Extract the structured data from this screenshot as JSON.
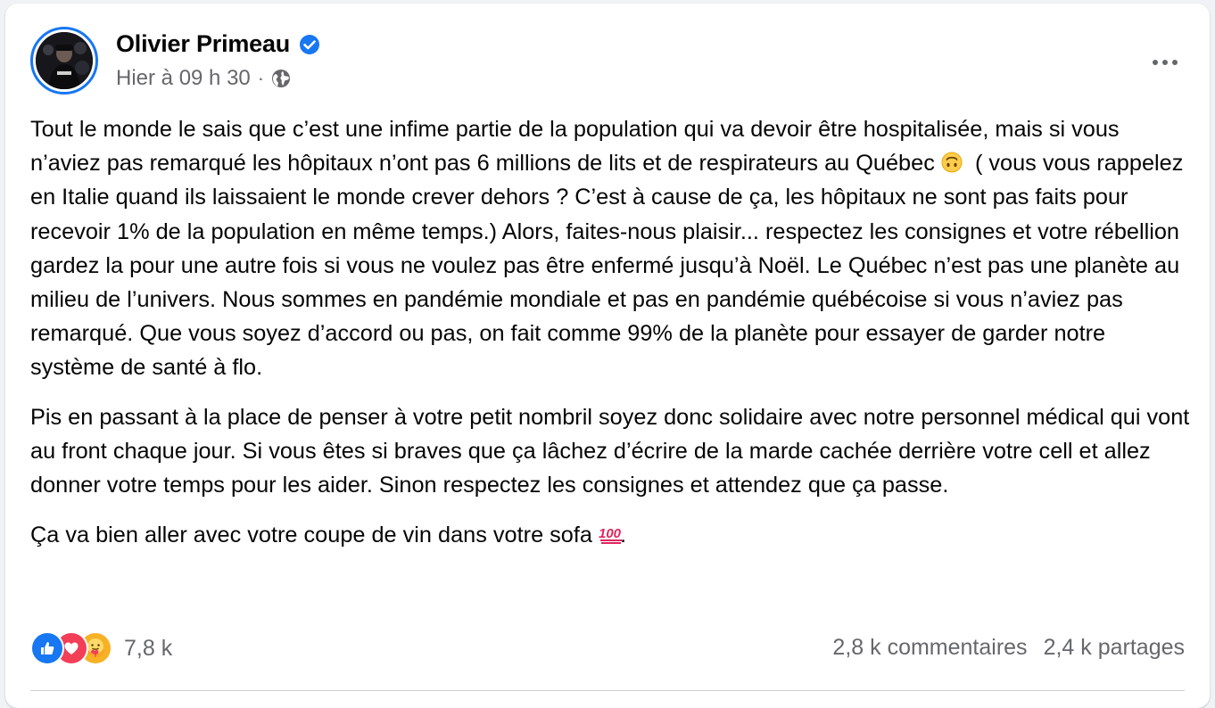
{
  "post": {
    "author": "Olivier Primeau",
    "verified": true,
    "timestamp": "Hier à 09 h 30",
    "separator": "·",
    "audience_icon": "globe-icon",
    "paragraphs": {
      "p1": {
        "before_emoji": "Tout le monde le sais que c’est une infime partie de la population qui va devoir être hospitalisée, mais si vous n’aviez pas remarqué les hôpitaux n’ont pas 6 millions de lits et de respirateurs au Québec",
        "emoji": "upside-down-face-emoji",
        "after_emoji": "( vous vous rappelez en Italie quand ils laissaient le monde crever dehors ? C’est à cause de ça, les hôpitaux ne sont pas faits pour recevoir 1% de la population en même temps.) Alors, faites-nous plaisir... respectez les consignes et votre rébellion gardez la pour une autre fois si vous ne voulez pas être enfermé jusqu’à Noël. Le Québec n’est pas une planète au milieu de l’univers. Nous sommes en pandémie mondiale et pas en pandémie québécoise si vous n’aviez pas remarqué. Que vous soyez d’accord ou pas, on fait comme 99% de la planète pour essayer de garder notre système de santé à flo."
      },
      "p2": "Pis en passant à la place de penser à votre petit nombril soyez donc solidaire avec notre personnel médical qui vont au front chaque jour. Si vous êtes si braves que ça lâchez d’écrire de la marde cachée derrière votre cell et allez donner votre temps pour les aider. Sinon respectez les consignes et attendez que ça passe.",
      "p3": {
        "before_emoji": "Ça va bien aller avec votre coupe de vin dans votre sofa",
        "emoji": "hundred-points-emoji",
        "after_emoji": "."
      }
    }
  },
  "footer": {
    "reactions": [
      "like-icon",
      "love-icon",
      "care-icon"
    ],
    "reaction_count": "7,8 k",
    "comments": "2,8 k commentaires",
    "shares": "2,4 k partages"
  },
  "colors": {
    "accent": "#1877f2",
    "secondary_text": "#65676b",
    "love": "#f33e58",
    "care": "#f7b125",
    "emoji_100": "#e0245e"
  }
}
